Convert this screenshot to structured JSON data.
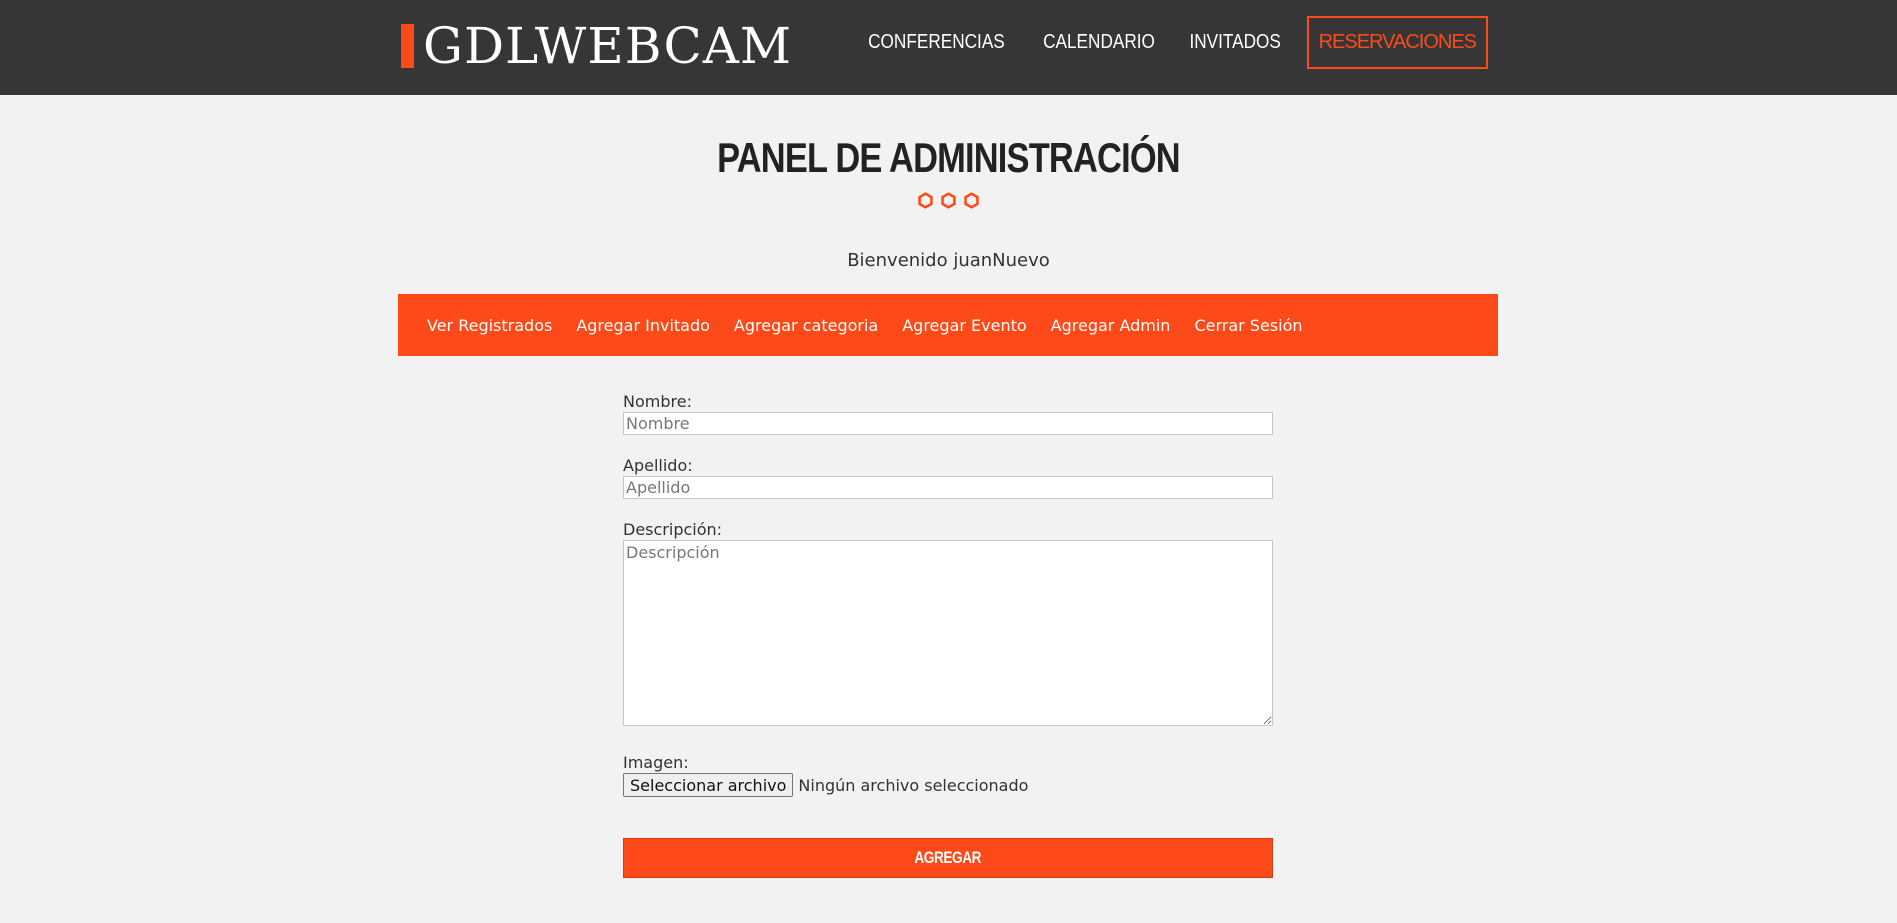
{
  "header": {
    "logo": "GDLWEBCAM",
    "nav": [
      "Conferencias",
      "Calendario",
      "Invitados",
      "Reservaciones"
    ]
  },
  "page": {
    "title": "Panel de Administración",
    "welcome": "Bienvenido juanNuevo"
  },
  "admin_nav": [
    "Ver Registrados",
    "Agregar Invitado",
    "Agregar categoria",
    "Agregar Evento",
    "Agregar Admin",
    "Cerrar Sesión"
  ],
  "form": {
    "nombre": {
      "label": "Nombre:",
      "placeholder": "Nombre",
      "value": ""
    },
    "apellido": {
      "label": "Apellido:",
      "placeholder": "Apellido",
      "value": ""
    },
    "descripcion": {
      "label": "Descripción:",
      "placeholder": "Descripción",
      "value": ""
    },
    "imagen": {
      "label": "Imagen:",
      "button": "Seleccionar archivo",
      "status": "Ningún archivo seleccionado"
    },
    "submit": "Agregar"
  },
  "colors": {
    "accent": "#fe4918",
    "header_bg": "#363636",
    "page_bg": "#f2f2f2"
  },
  "icons": [
    "hexagon-icon",
    "hexagon-icon",
    "hexagon-icon"
  ]
}
